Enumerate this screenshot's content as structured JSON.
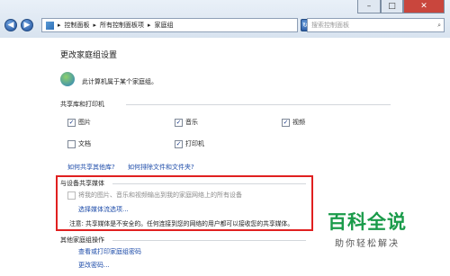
{
  "window": {
    "minimize": "–",
    "maximize": "□",
    "close": "✕"
  },
  "breadcrumb": {
    "home": "控制面板",
    "all": "所有控制面板项",
    "current": "家庭组"
  },
  "search": {
    "placeholder": "搜索控制面板"
  },
  "page": {
    "title": "更改家庭组设置",
    "status": "此计算机属于某个家庭组。",
    "section_libraries": "共享库和打印机",
    "items": [
      {
        "label": "图片",
        "checked": true
      },
      {
        "label": "音乐",
        "checked": true
      },
      {
        "label": "视频",
        "checked": true
      },
      {
        "label": "文档",
        "checked": false
      },
      {
        "label": "打印机",
        "checked": true
      }
    ],
    "link_share_other": "如何共享其他库?",
    "link_exclude": "如何排除文件和文件夹?",
    "section_media": "与设备共享媒体",
    "media_option": "将我的图片、音乐和视频输出到我的家庭网络上的所有设备",
    "media_link": "选择媒体流选项...",
    "media_note": "注意: 共享媒体是不安全的。任何连接到您的网络的用户都可以接收您的共享媒体。",
    "section_other": "其他家庭组操作",
    "link_password": "查看或打印家庭组密码",
    "link_change_password": "更改密码..."
  },
  "watermark": {
    "main": "百科全说",
    "sub": "助你轻松解决"
  },
  "colors": {
    "highlight_border": "#e02020",
    "link": "#1b4aa8"
  }
}
